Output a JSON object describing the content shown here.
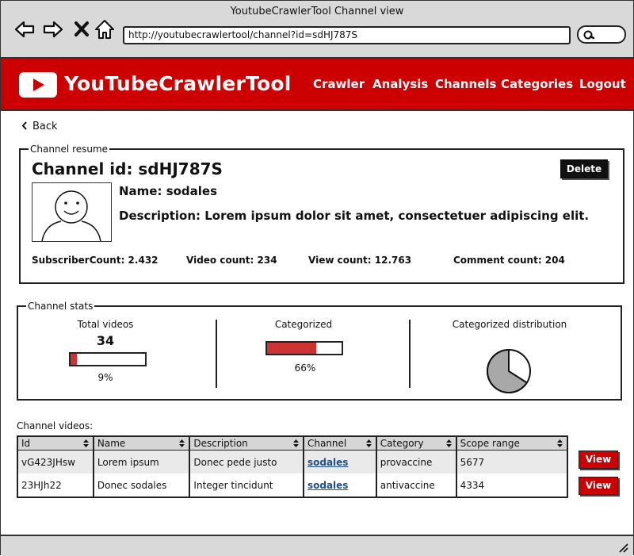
{
  "window": {
    "title": "YoutubeCrawlerTool Channel view"
  },
  "browser": {
    "url": "http://youtubecrawlertool/channel?id=sdHJ787S",
    "icons": [
      "back-arrow-icon",
      "forward-arrow-icon",
      "close-x-icon",
      "home-icon",
      "search-icon"
    ]
  },
  "header": {
    "brand": "YouTubeCrawlerTool",
    "menu": [
      "Crawler",
      "Analysis",
      "Channels",
      "Categories",
      "Logout"
    ]
  },
  "back_label": "Back",
  "resume": {
    "legend": "Channel resume",
    "channel_id": "Channel id: sdHJ787S",
    "delete_label": "Delete",
    "name": "Name: sodales",
    "description": "Description: Lorem ipsum dolor sit amet, consectetuer adipiscing elit.",
    "counts": {
      "subscribers": "SubscriberCount: 2.432",
      "videos": "Video count: 234",
      "views": "View count: 12.763",
      "comments": "Comment count: 204"
    }
  },
  "stats": {
    "legend": "Channel stats",
    "total_videos": {
      "title": "Total videos",
      "value": "34",
      "percent_label": "9%",
      "fraction": 0.09
    },
    "categorized": {
      "title": "Categorized",
      "percent_label": "66%",
      "fraction": 0.66
    },
    "distribution": {
      "title": "Categorized distribution",
      "fraction": 0.66
    }
  },
  "videos": {
    "label": "Channel videos:",
    "columns": [
      "Id",
      "Name",
      "Description",
      "Channel",
      "Category",
      "Scope range"
    ],
    "rows": [
      {
        "id": "vG423JHsw",
        "name": "Lorem ipsum",
        "description": "Donec pede justo",
        "channel": "sodales",
        "category": "provaccine",
        "scope": "5677",
        "action": "View"
      },
      {
        "id": "23HJh22",
        "name": "Donec sodales",
        "description": "Integer tincidunt",
        "channel": "sodales",
        "category": "antivaccine",
        "scope": "4334",
        "action": "View"
      }
    ]
  },
  "colors": {
    "accent": "#cc0000",
    "bar_fill": "#cc3333",
    "link": "#1f4f8a",
    "pie_fill": "#a8a8a8"
  }
}
